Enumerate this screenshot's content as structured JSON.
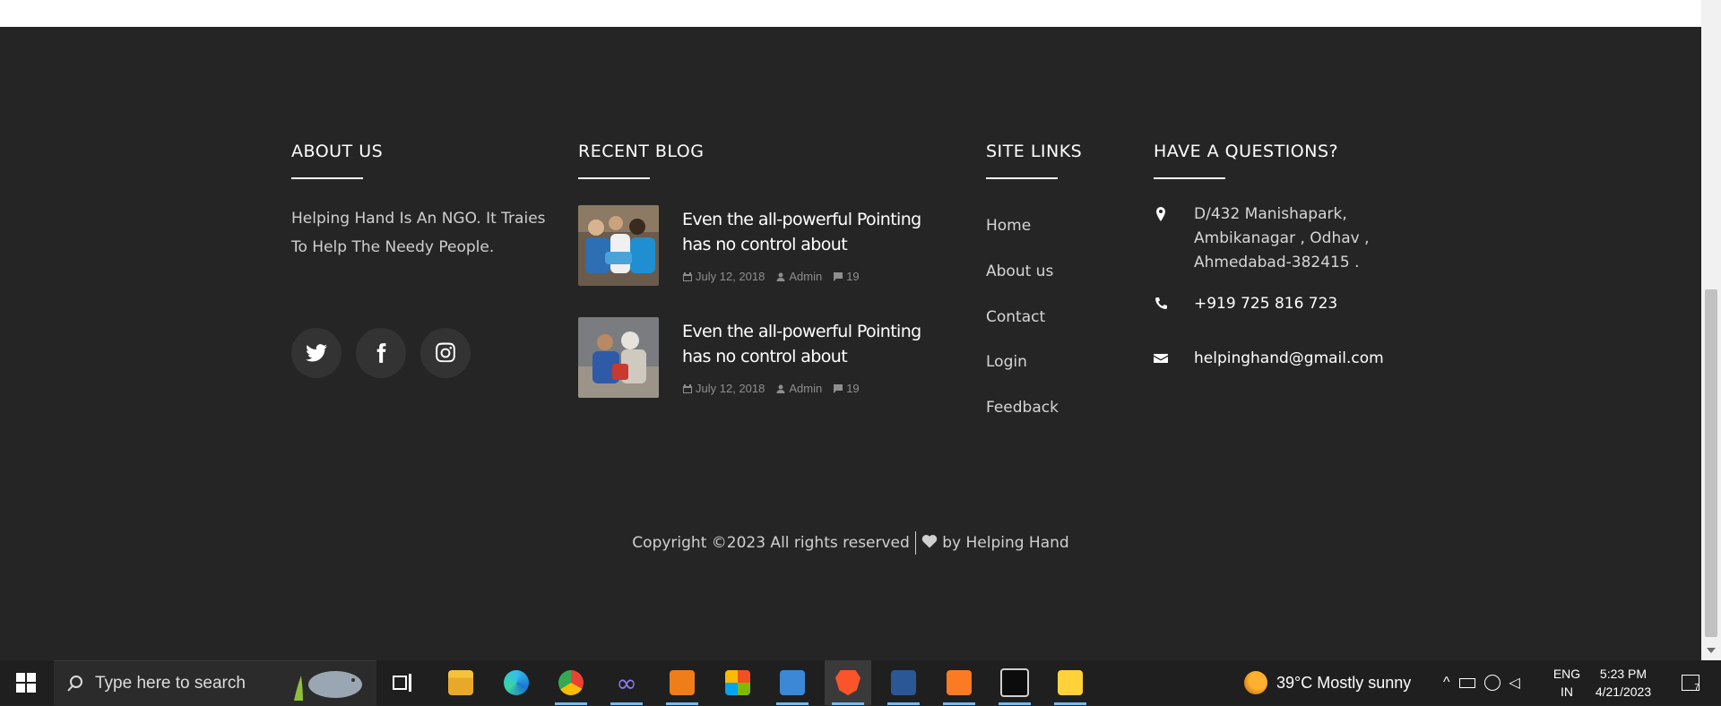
{
  "footer": {
    "about": {
      "heading": "ABOUT US",
      "text": "Helping Hand Is An NGO. It Traies To Help The Needy People.",
      "social": [
        {
          "name": "twitter-icon"
        },
        {
          "name": "facebook-icon"
        },
        {
          "name": "instagram-icon"
        }
      ]
    },
    "blog": {
      "heading": "RECENT BLOG",
      "items": [
        {
          "title": "Even the all-powerful Pointing has no control about",
          "date": "July 12, 2018",
          "author": "Admin",
          "comments": "19"
        },
        {
          "title": "Even the all-powerful Pointing has no control about",
          "date": "July 12, 2018",
          "author": "Admin",
          "comments": "19"
        }
      ]
    },
    "links": {
      "heading": "SITE LINKS",
      "items": [
        "Home",
        "About us",
        "Contact",
        "Login",
        "Feedback"
      ]
    },
    "contact": {
      "heading": "HAVE A QUESTIONS?",
      "address": "D/432 Manishapark, Ambikanagar , Odhav , Ahmedabad-382415 .",
      "phone": "+919 725 816 723",
      "email": "helpinghand@gmail.com"
    },
    "copyright": {
      "prefix": "Copyright ©2023 All rights reserved",
      "suffix": "by Helping Hand"
    }
  },
  "taskbar": {
    "search_placeholder": "Type here to search",
    "weather": "39°C  Mostly sunny",
    "language_line1": "ENG",
    "language_line2": "IN",
    "time": "5:23 PM",
    "date": "4/21/2023",
    "notification_count": "7"
  },
  "colors": {
    "footer_bg": "#252525",
    "taskbar_bg": "#1f1f1f",
    "accent": "#76b9ed"
  }
}
